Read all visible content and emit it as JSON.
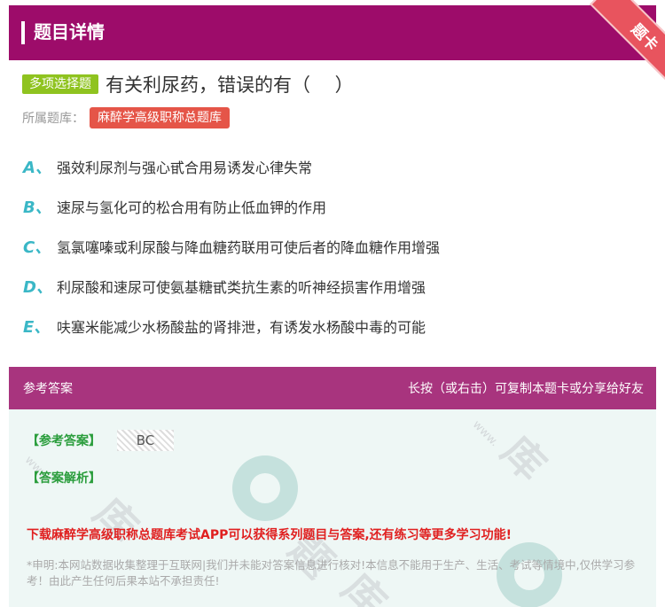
{
  "header": {
    "title": "题目详情"
  },
  "ribbon": {
    "label": "题卡"
  },
  "question": {
    "type_label": "多项选择题",
    "text": "有关利尿药，错误的有（　 ）",
    "bank_label": "所属题库：",
    "bank_name": "麻醉学高级职称总题库"
  },
  "options": [
    {
      "letter": "A、",
      "text": "强效利尿剂与强心甙合用易诱发心律失常"
    },
    {
      "letter": "B、",
      "text": "速尿与氢化可的松合用有防止低血钾的作用"
    },
    {
      "letter": "C、",
      "text": "氢氯噻嗪或利尿酸与降血糖药联用可使后者的降血糖作用增强"
    },
    {
      "letter": "D、",
      "text": "利尿酸和速尿可使氨基糖甙类抗生素的听神经损害作用增强"
    },
    {
      "letter": "E、",
      "text": "呋塞米能减少水杨酸盐的肾排泄，有诱发水杨酸中毒的可能"
    }
  ],
  "answer_section": {
    "title": "参考答案",
    "share_hint": "长按（或右击）可复制本题卡或分享给好友",
    "answer_label": "【参考答案】",
    "answer_value": "BC",
    "analysis_label": "【答案解析】",
    "promo": "下载麻醉学高级职称总题库考试APP可以获得系列题目与答案,还有练习等更多学习功能!",
    "declaration": "*申明:本网站数据收集整理于互联网|我们并未能对答案信息进行核对!本信息不能用于生产、生活、考试等情境中,仅供学习参考！由此产生任何后果本站不承担责任!"
  },
  "colors": {
    "header_bg": "#9d0c6a",
    "answer_bar_bg": "#a8347e",
    "type_tag": "#8fc31f",
    "bank_tag": "#e55548",
    "option_letter": "#3ab7c6",
    "answer_green": "#2a9d3c",
    "promo_red": "#e02020"
  }
}
